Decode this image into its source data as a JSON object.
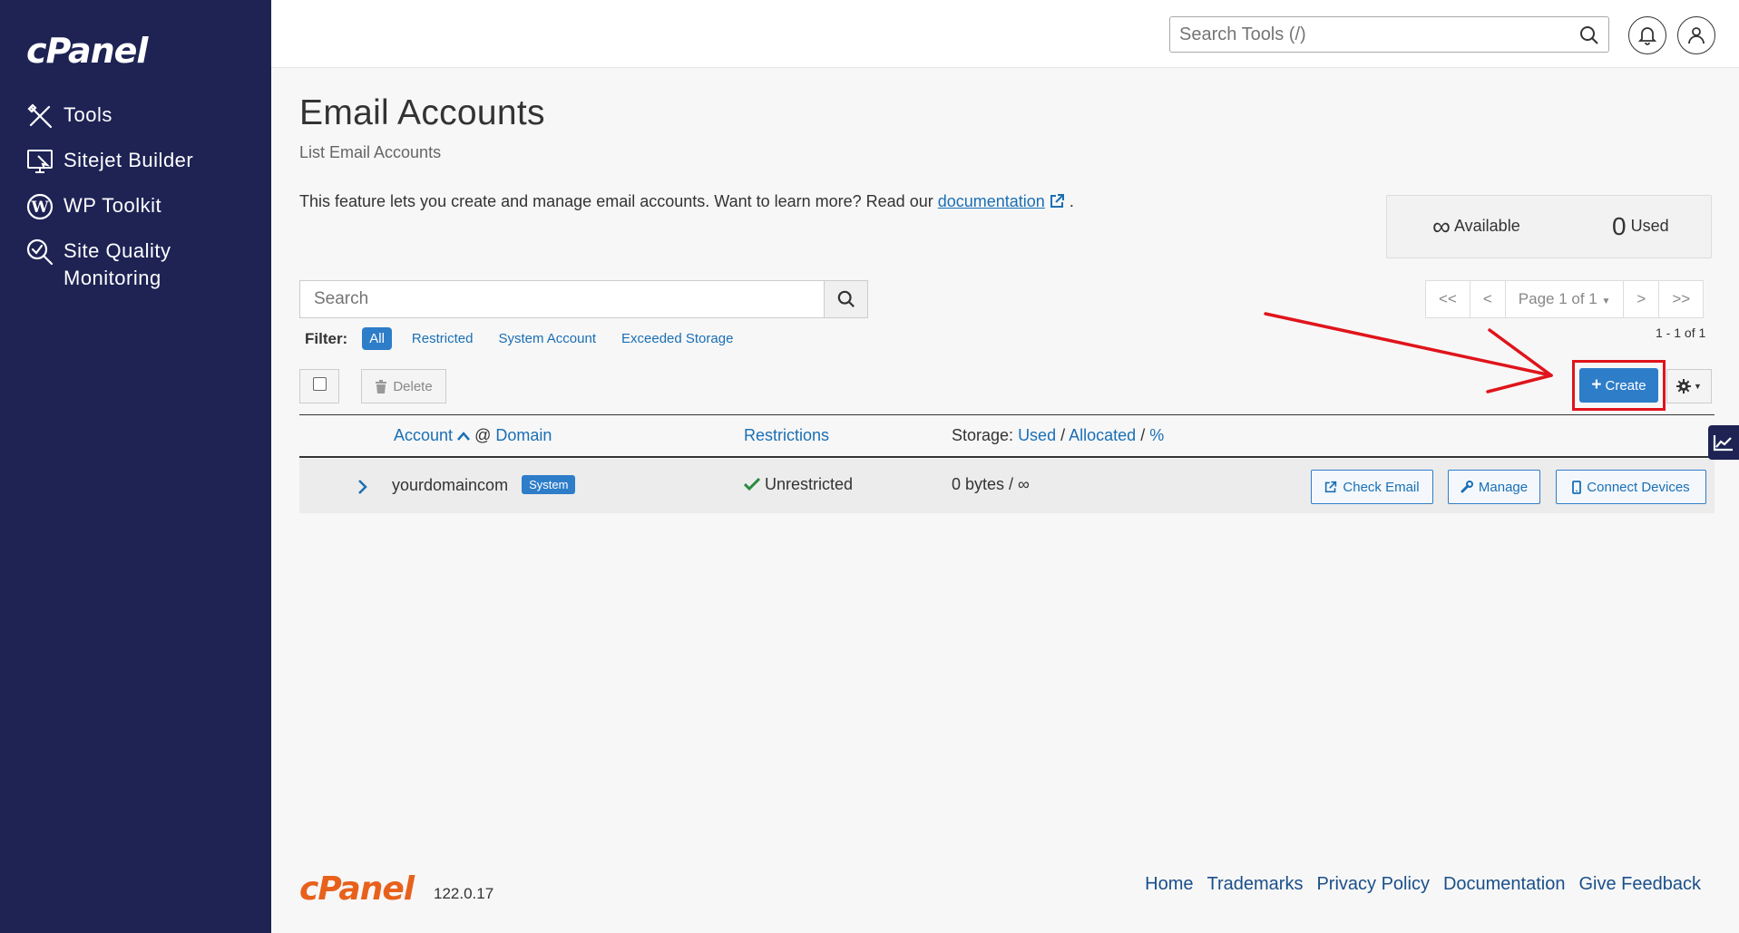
{
  "sidebar": {
    "logo": "cPanel",
    "items": [
      {
        "label": "Tools",
        "icon": "tools-icon"
      },
      {
        "label": "Sitejet Builder",
        "icon": "sitejet-icon"
      },
      {
        "label": "WP Toolkit",
        "icon": "wordpress-icon"
      },
      {
        "label": "Site Quality Monitoring",
        "icon": "site-quality-icon"
      }
    ]
  },
  "topbar": {
    "search_placeholder": "Search Tools (/)"
  },
  "page": {
    "title": "Email Accounts",
    "subtitle": "List Email Accounts",
    "intro_text": "This feature lets you create and manage email accounts. Want to learn more? Read our",
    "intro_link": "documentation",
    "intro_end": "."
  },
  "stats": {
    "available_value": "∞",
    "available_label": "Available",
    "used_value": "0",
    "used_label": "Used"
  },
  "search": {
    "placeholder": "Search"
  },
  "filter": {
    "label": "Filter:",
    "options": [
      "All",
      "Restricted",
      "System Account",
      "Exceeded Storage"
    ],
    "active": "All"
  },
  "pagination": {
    "first": "<<",
    "prev": "<",
    "page": "Page 1 of 1",
    "next": ">",
    "last": ">>",
    "range": "1 - 1 of 1"
  },
  "toolbar": {
    "delete_label": "Delete",
    "create_label": "Create"
  },
  "table": {
    "col_account": "Account",
    "col_at": "@",
    "col_domain": "Domain",
    "col_restrictions": "Restrictions",
    "col_storage_prefix": "Storage:",
    "col_used": "Used",
    "col_allocated": "Allocated",
    "col_percent": "%",
    "sep": "/",
    "rows": [
      {
        "account": "yourdomaincom",
        "badge": "System",
        "restriction": "Unrestricted",
        "storage": "0 bytes / ∞",
        "actions": [
          "Check Email",
          "Manage",
          "Connect Devices"
        ]
      }
    ]
  },
  "footer": {
    "logo": "cPanel",
    "version": "122.0.17",
    "links": [
      "Home",
      "Trademarks",
      "Privacy Policy",
      "Documentation",
      "Give Feedback"
    ]
  },
  "colors": {
    "sidebar_bg": "#1e2354",
    "primary": "#2e7dc9",
    "highlight": "#e0141b",
    "footer_logo": "#e8611c"
  }
}
